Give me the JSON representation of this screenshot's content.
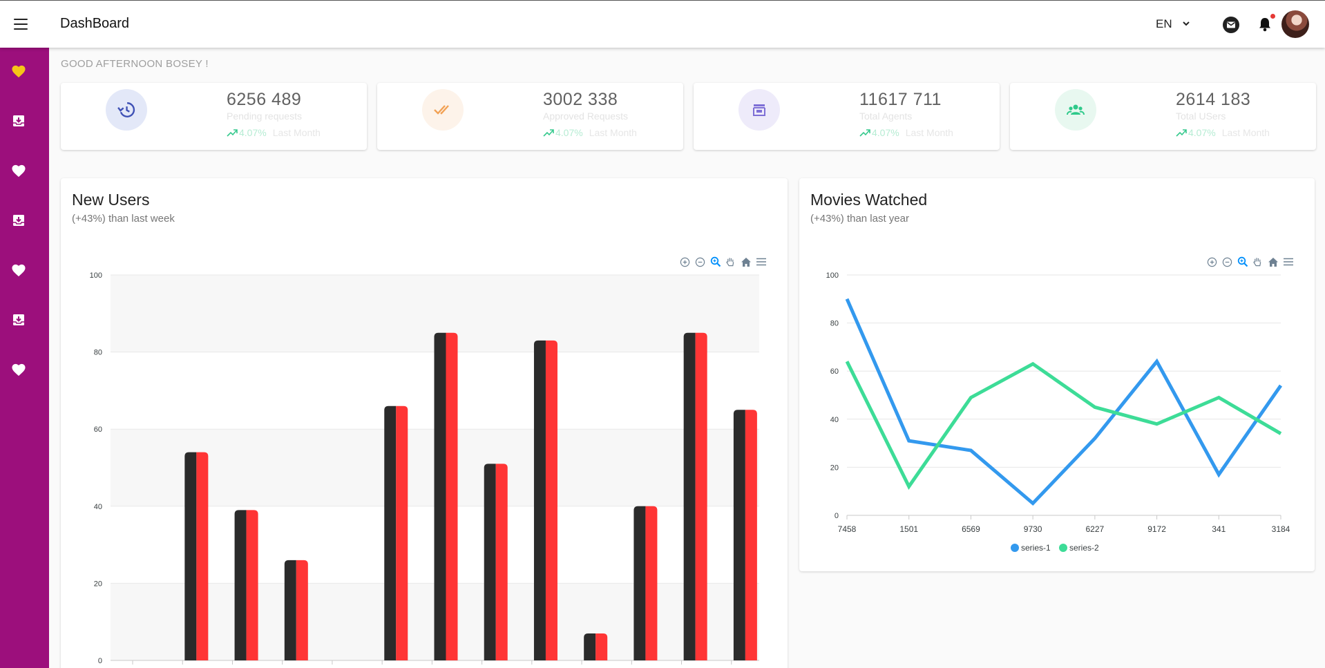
{
  "header": {
    "title": "DashBoard",
    "language": "EN"
  },
  "sidebar": {
    "items": [
      {
        "icon": "heart-icon",
        "active": true
      },
      {
        "icon": "inbox-download-icon"
      },
      {
        "icon": "heart-icon"
      },
      {
        "icon": "inbox-download-icon"
      },
      {
        "icon": "heart-icon"
      },
      {
        "icon": "inbox-download-icon"
      },
      {
        "icon": "heart-icon"
      }
    ]
  },
  "greeting": "GOOD AFTERNOON BOSEY !",
  "stats": [
    {
      "value": "6256 489",
      "label": "Pending requests",
      "trend": "4.07%",
      "period": "Last Month",
      "icon": "history-icon",
      "icon_color": "#3f51b5",
      "icon_bg": "#e3e8f8"
    },
    {
      "value": "3002 338",
      "label": "Approved Requests",
      "trend": "4.07%",
      "period": "Last Month",
      "icon": "double-check-icon",
      "icon_color": "#f2a154",
      "icon_bg": "#fdf3ea"
    },
    {
      "value": "11617 711",
      "label": "Total Agents",
      "trend": "4.07%",
      "period": "Last Month",
      "icon": "store-icon",
      "icon_color": "#7e6fd6",
      "icon_bg": "#eeebfa"
    },
    {
      "value": "2614 183",
      "label": "Total USers",
      "trend": "4.07%",
      "period": "Last Month",
      "icon": "users-icon",
      "icon_color": "#2ec98a",
      "icon_bg": "#e8f8f0"
    }
  ],
  "new_users": {
    "title": "New Users",
    "subtitle": "(+43%) than last week"
  },
  "movies": {
    "title": "Movies Watched",
    "subtitle": "(+43%) than last year"
  },
  "chart_data": [
    {
      "type": "bar",
      "title": "New Users",
      "y_ticks": [
        "0",
        "20",
        "40",
        "60",
        "80",
        "100"
      ],
      "ylim": [
        0,
        100
      ],
      "values": [
        0,
        54,
        39,
        26,
        0,
        66,
        85,
        51,
        83,
        7,
        40,
        85,
        65
      ],
      "colors": [
        "#2b2b2b",
        "#ff3535"
      ],
      "grid": true,
      "banded": true
    },
    {
      "type": "line",
      "title": "Movies Watched",
      "categories": [
        "7458",
        "1501",
        "6569",
        "9730",
        "6227",
        "9172",
        "341",
        "3184"
      ],
      "y_ticks": [
        "0",
        "20",
        "40",
        "60",
        "80",
        "100"
      ],
      "ylim": [
        0,
        100
      ],
      "series": [
        {
          "name": "series-1",
          "values": [
            90,
            31,
            27,
            5,
            32,
            64,
            17,
            54
          ],
          "color": "#3399ee"
        },
        {
          "name": "series-2",
          "values": [
            64,
            12,
            49,
            63,
            45,
            38,
            49,
            34
          ],
          "color": "#3ddc97"
        }
      ],
      "legend": "bottom-center",
      "grid": true
    }
  ]
}
